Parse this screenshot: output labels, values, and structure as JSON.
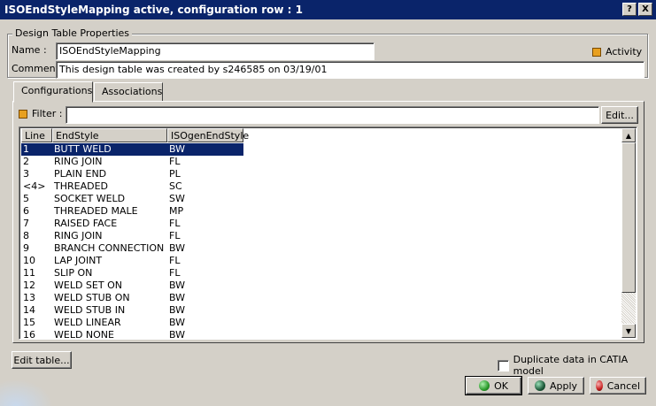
{
  "window": {
    "title": "ISOEndStyleMapping active, configuration row : 1",
    "help_label": "?",
    "close_label": "X"
  },
  "properties": {
    "group_title": "Design Table Properties",
    "name_label": "Name :",
    "name_value": "ISOEndStyleMapping",
    "comment_label": "Comment :",
    "comment_value": "This design table was created by s246585 on 03/19/01",
    "activity_label": "Activity"
  },
  "tabs": [
    {
      "label": "Configurations"
    },
    {
      "label": "Associations"
    }
  ],
  "filter": {
    "label": "Filter :",
    "value": "",
    "edit_label": "Edit..."
  },
  "table": {
    "columns": [
      "Line",
      "EndStyle",
      "ISOgenEndStyle"
    ],
    "rows": [
      [
        "1",
        "BUTT WELD",
        "BW"
      ],
      [
        "2",
        "RING JOIN",
        "FL"
      ],
      [
        "3",
        "PLAIN END",
        "PL"
      ],
      [
        "<4>",
        "THREADED",
        "SC"
      ],
      [
        "5",
        "SOCKET WELD",
        "SW"
      ],
      [
        "6",
        "THREADED MALE",
        "MP"
      ],
      [
        "7",
        "RAISED FACE",
        "FL"
      ],
      [
        "8",
        "RING JOIN",
        "FL"
      ],
      [
        "9",
        "BRANCH CONNECTION",
        "BW"
      ],
      [
        "10",
        "LAP JOINT",
        "FL"
      ],
      [
        "11",
        "SLIP ON",
        "FL"
      ],
      [
        "12",
        "WELD SET ON",
        "BW"
      ],
      [
        "13",
        "WELD STUB ON",
        "BW"
      ],
      [
        "14",
        "WELD STUB IN",
        "BW"
      ],
      [
        "15",
        "WELD LINEAR",
        "BW"
      ],
      [
        "16",
        "WELD NONE",
        "BW"
      ]
    ]
  },
  "bottom": {
    "edit_table_label": "Edit table...",
    "duplicate_label": "Duplicate data in CATIA model",
    "ok_label": "OK",
    "apply_label": "Apply",
    "cancel_label": "Cancel"
  },
  "colors": {
    "title_bg": "#0a246a",
    "selection": "#0a246a",
    "ok_dot": "#2a9a2a",
    "apply_dot": "#1e5a3a",
    "cancel_dot": "#c82020"
  }
}
